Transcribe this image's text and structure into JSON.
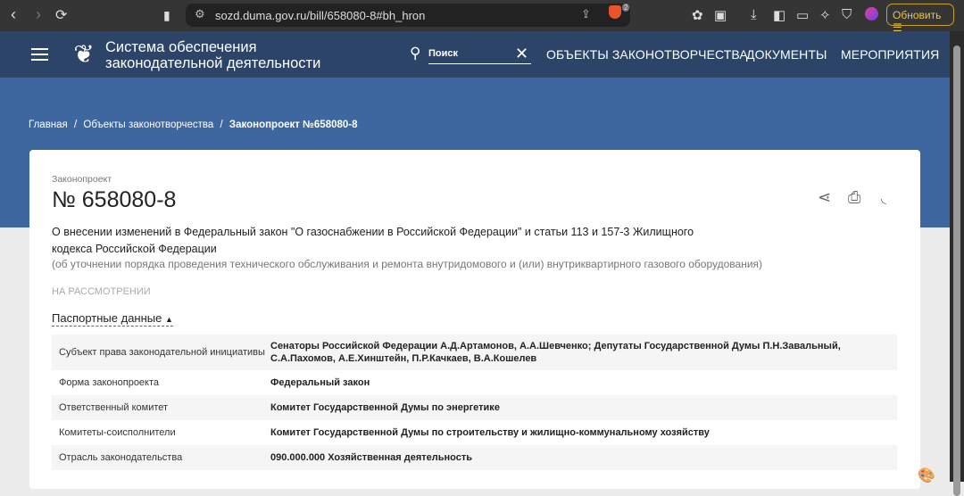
{
  "browser": {
    "url": "sozd.duma.gov.ru/bill/658080-8#bh_hron",
    "brave_badge": "2",
    "update_label": "Обновить"
  },
  "header": {
    "brand_line1": "Система обеспечения",
    "brand_line2": "законодательной деятельности",
    "search_placeholder": "Поиск",
    "nav": [
      "ОБЪЕКТЫ ЗАКОНОТВОРЧЕСТВА",
      "ДОКУМЕНТЫ",
      "МЕРОПРИЯТИЯ"
    ]
  },
  "breadcrumbs": [
    "Главная",
    "/",
    "Объекты законотворчества",
    "/",
    "Законопроект №658080-8"
  ],
  "bill": {
    "label": "Законопроект",
    "number": "№ 658080-8",
    "title": "О внесении изменений в Федеральный закон \"О газоснабжении в Российской Федерации\" и статьи 113 и 157-3 Жилищного кодекса Российской Федерации",
    "subtitle": "(об уточнении порядка проведения технического обслуживания и ремонта внутридомового и (или) внутриквартирного газового оборудования)",
    "status": "НА РАССМОТРЕНИИ",
    "passport_label": "Паспортные данные"
  },
  "passport": [
    {
      "k": "Субъект права законодательной инициативы",
      "v": "Сенаторы Российской Федерации А.Д.Артамонов, А.А.Шевченко; Депутаты Государственной Думы П.Н.Завальный, С.А.Пахомов, А.Е.Хинштейн, П.Р.Качкаев, В.А.Кошелев"
    },
    {
      "k": "Форма законопроекта",
      "v": "Федеральный закон"
    },
    {
      "k": "Ответственный комитет",
      "v": "Комитет Государственной Думы по энергетике"
    },
    {
      "k": "Комитеты-соисполнители",
      "v": "Комитет Государственной Думы по строительству и жилищно-коммунальному хозяйству"
    },
    {
      "k": "Отрасль законодательства",
      "v": "090.000.000 Хозяйственная деятельность"
    }
  ]
}
